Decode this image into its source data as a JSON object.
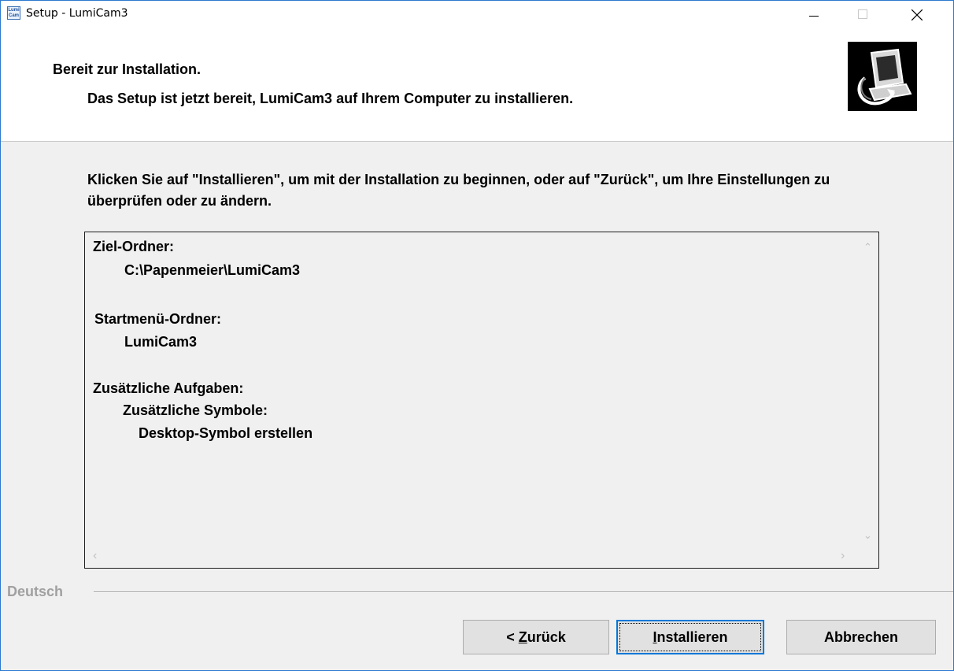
{
  "window": {
    "title": "Setup - LumiCam3",
    "icon_text": "Lumi Cam",
    "controls": [
      "minimize-icon",
      "maximize-icon",
      "close-icon"
    ]
  },
  "header": {
    "title": "Bereit zur Installation.",
    "subtitle": "Das Setup ist jetzt bereit, LumiCam3 auf Ihrem Computer zu installieren.",
    "logo_icon": "computer-install-icon"
  },
  "intro_text": "Klicken Sie auf \"Installieren\", um mit der Installation zu beginnen, oder auf \"Zurück\", um Ihre Einstellungen zu überprüfen oder zu ändern.",
  "summary": {
    "dest_label": "Ziel-Ordner:",
    "dest_value": "C:\\Papenmeier\\LumiCam3",
    "startmenu_label": "Startmenü-Ordner:",
    "startmenu_value": "LumiCam3",
    "tasks_label": "Zusätzliche Aufgaben:",
    "tasks_group": "Zusätzliche Symbole:",
    "tasks_item": "Desktop-Symbol erstellen"
  },
  "language_label": "Deutsch",
  "buttons": {
    "back_prefix": "< ",
    "back_hotkey": "Z",
    "back_rest": "urück",
    "install_hotkey": "I",
    "install_rest": "nstallieren",
    "cancel": "Abbrechen"
  },
  "colors": {
    "window_border": "#2b79d0",
    "focus_blue": "#0078d7",
    "background": "#f0f0f0"
  }
}
